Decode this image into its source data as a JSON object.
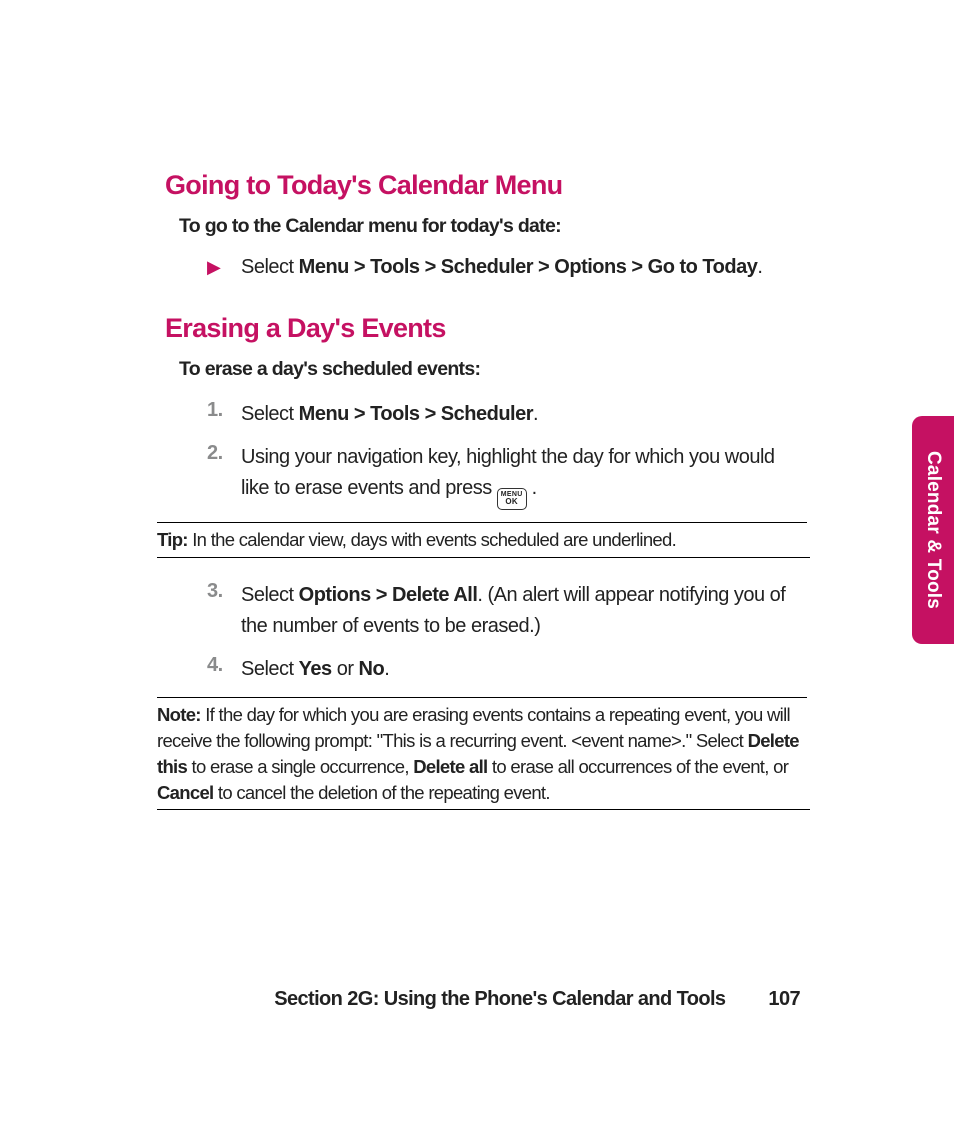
{
  "section1": {
    "title": "Going to Today's Calendar Menu",
    "lead": "To go to the Calendar menu for today's date:",
    "bullet": {
      "pre": "Select ",
      "path": "Menu > Tools > Scheduler > Options > Go to Today",
      "post": "."
    }
  },
  "section2": {
    "title": "Erasing a Day's Events",
    "lead": "To erase a day's scheduled events:",
    "steps": {
      "s1": {
        "num": "1.",
        "pre": "Select ",
        "bold": "Menu > Tools > Scheduler",
        "post": "."
      },
      "s2": {
        "num": "2.",
        "text_a": "Using your navigation key, highlight the day for which you would like to erase events and press ",
        "key1": "MENU",
        "key2": "OK",
        "text_b": "."
      },
      "s3": {
        "num": "3.",
        "pre": "Select ",
        "bold": "Options > Delete All",
        "post": ". (An alert will appear notifying you of the number of events to be erased.)"
      },
      "s4": {
        "num": "4.",
        "pre": "Select ",
        "b1": "Yes",
        "mid": " or ",
        "b2": "No",
        "post": "."
      }
    },
    "tip": {
      "label": "Tip:",
      "text": " In the calendar view, days with events scheduled are underlined."
    },
    "note": {
      "label": "Note:",
      "t1": " If the day for which you are erasing events contains a repeating event, you will receive the following prompt: \"This is a recurring event. <event name>.\" Select ",
      "b1": "Delete this",
      "t2": " to erase a single occurrence, ",
      "b2": "Delete all",
      "t3": " to erase all occurrences of the event, or ",
      "b3": "Cancel",
      "t4": " to cancel the deletion of the repeating event."
    }
  },
  "sidetab": "Calendar & Tools",
  "footer": {
    "section": "Section 2G: Using the Phone's Calendar and Tools",
    "page": "107"
  }
}
